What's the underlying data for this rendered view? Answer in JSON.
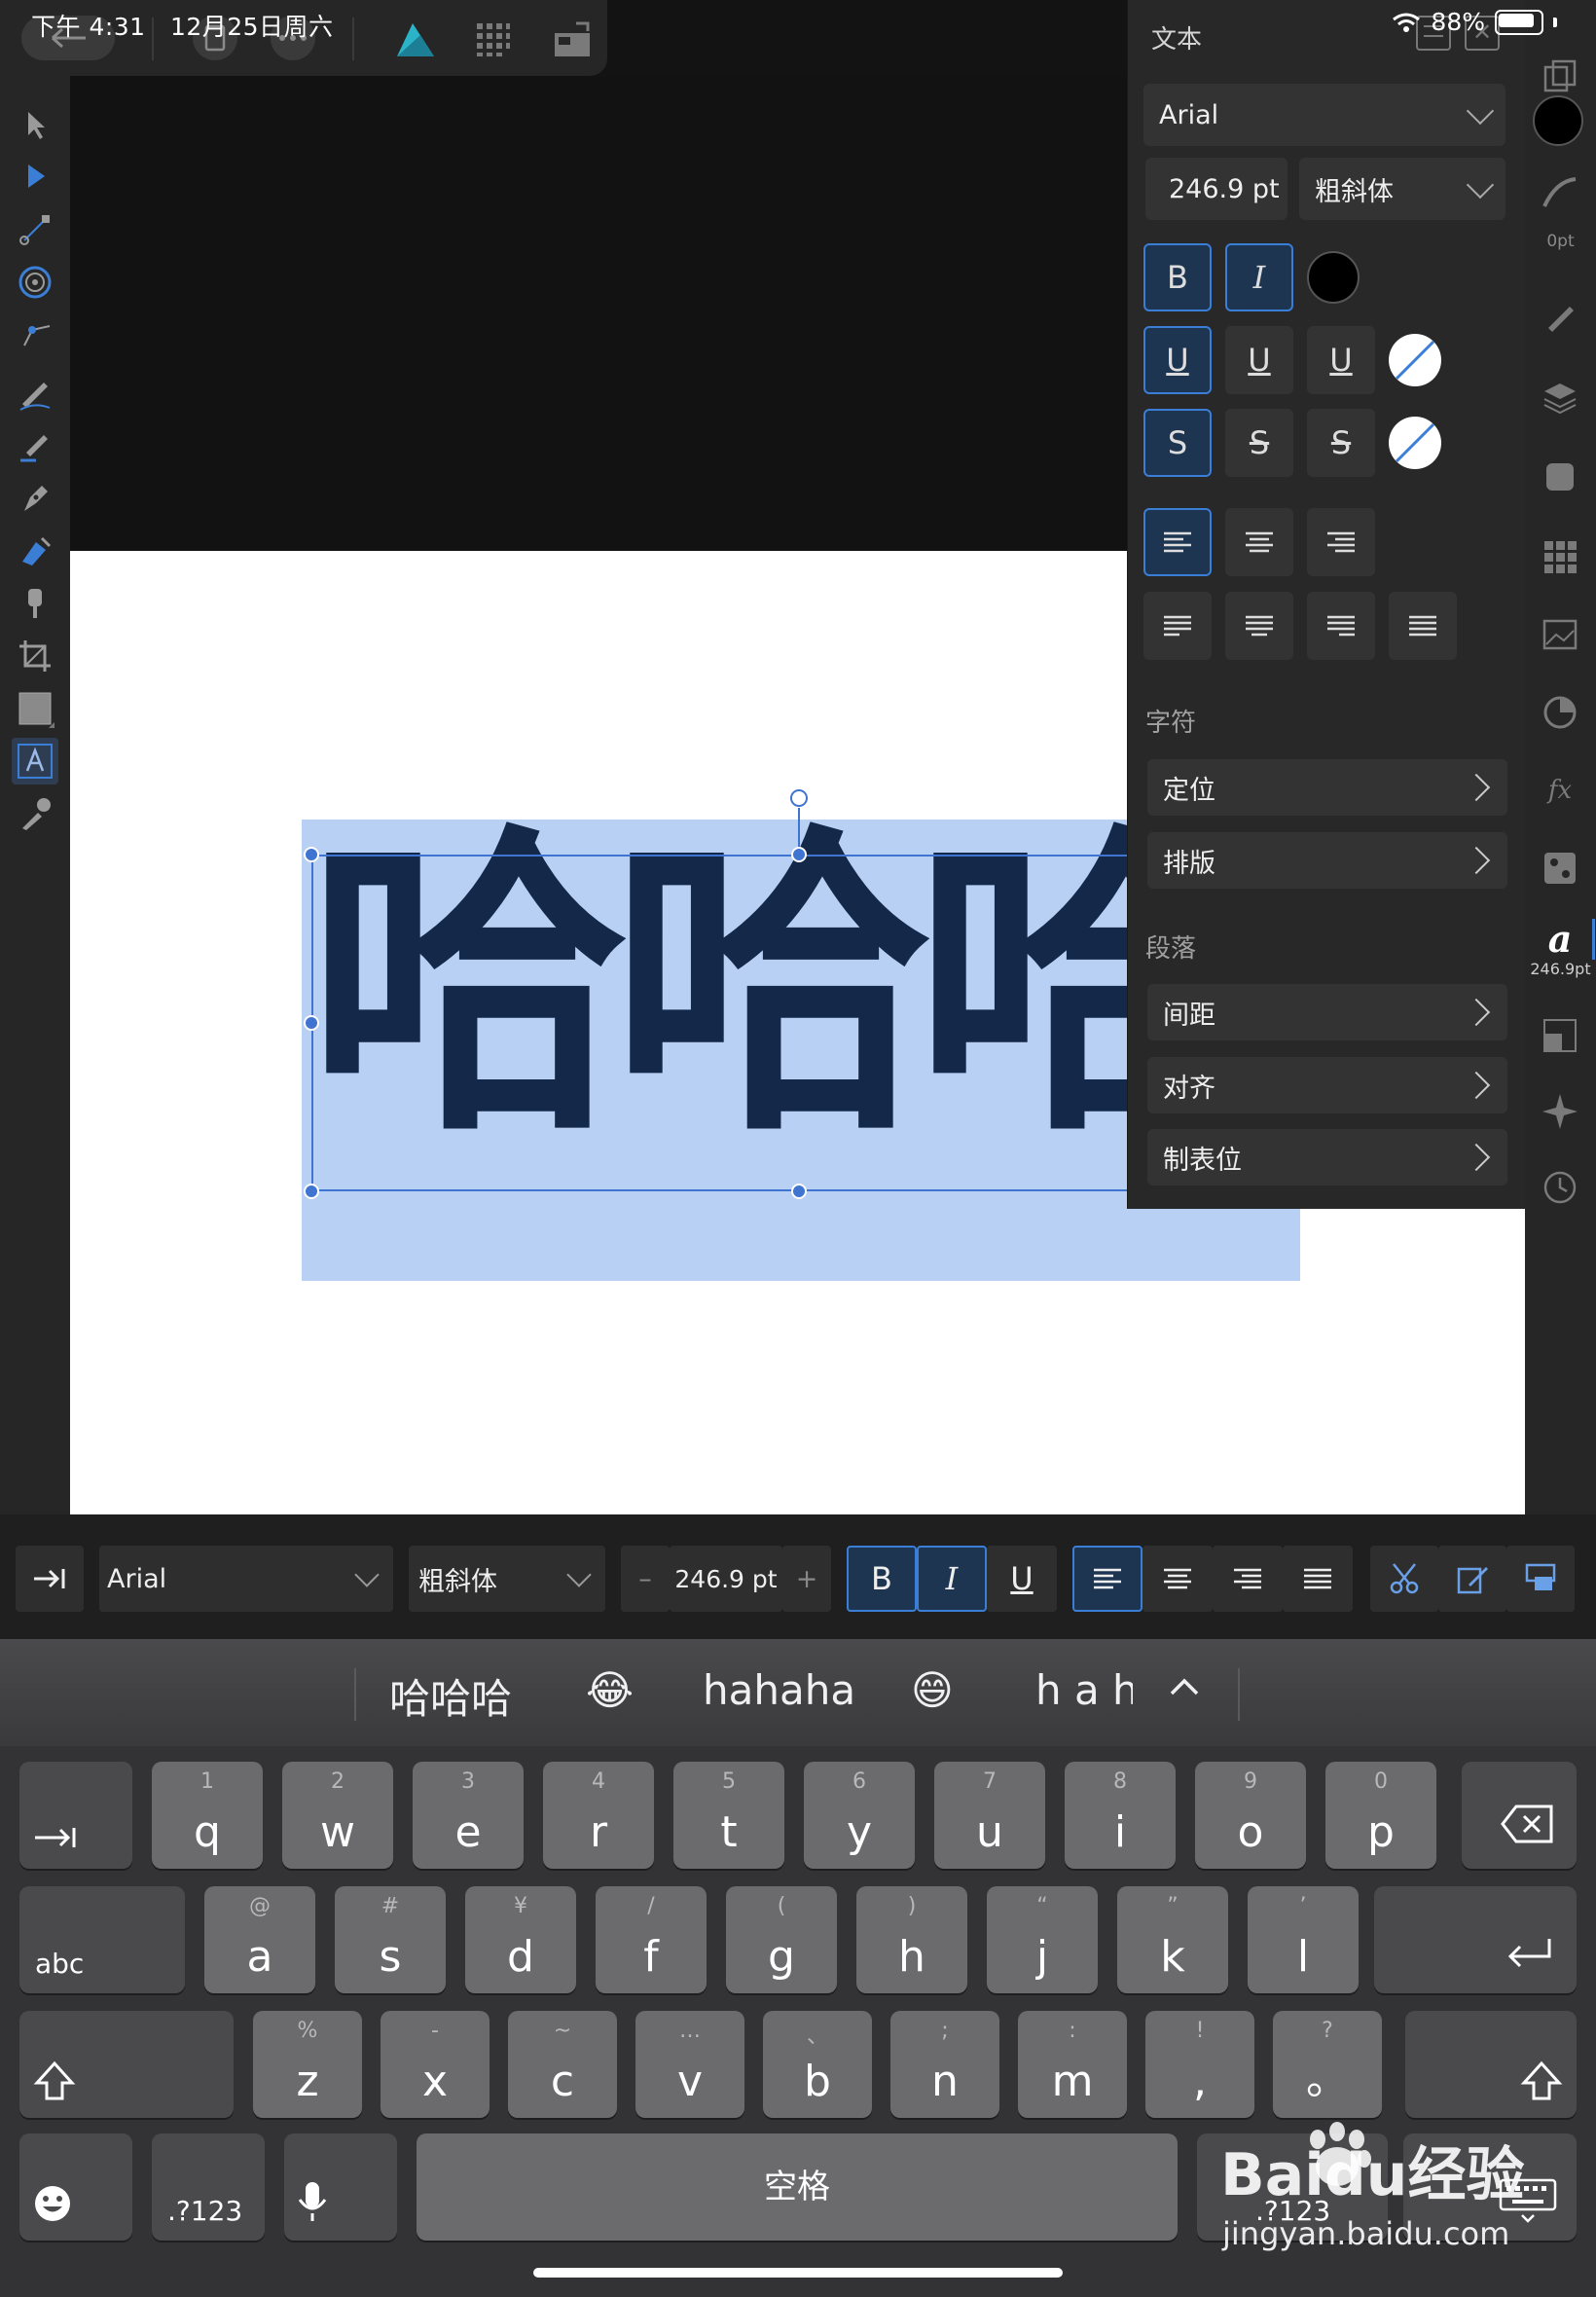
{
  "status_bar": {
    "time": "下午 4:31",
    "date": "12月25日周六",
    "battery": "88%"
  },
  "canvas": {
    "text": "哈哈哈"
  },
  "text_panel": {
    "title": "文本",
    "font": "Arial",
    "size": "246.9 pt",
    "style": "粗斜体",
    "bold_label": "B",
    "italic_label": "I",
    "underline_labels": [
      "U",
      "U",
      "U"
    ],
    "strike_labels": [
      "S",
      "S",
      "S"
    ],
    "character_section": "字符",
    "character_rows": [
      "定位",
      "排版"
    ],
    "paragraph_section": "段落",
    "paragraph_rows": [
      "间距",
      "对齐",
      "制表位"
    ]
  },
  "right_strip": {
    "stroke_width": "0pt",
    "text_size": "246.9pt",
    "text_glyph": "a"
  },
  "context_toolbar": {
    "font": "Arial",
    "style": "粗斜体",
    "size": "246.9 pt",
    "minus": "–",
    "plus": "+",
    "bold": "B",
    "italic": "I",
    "underline": "U"
  },
  "keyboard": {
    "suggestions": [
      "哈哈哈",
      "😂",
      "hahaha",
      "😄",
      "h a h"
    ],
    "row1": [
      {
        "hint": "1",
        "key": "q"
      },
      {
        "hint": "2",
        "key": "w"
      },
      {
        "hint": "3",
        "key": "e"
      },
      {
        "hint": "4",
        "key": "r"
      },
      {
        "hint": "5",
        "key": "t"
      },
      {
        "hint": "6",
        "key": "y"
      },
      {
        "hint": "7",
        "key": "u"
      },
      {
        "hint": "8",
        "key": "i"
      },
      {
        "hint": "9",
        "key": "o"
      },
      {
        "hint": "0",
        "key": "p"
      }
    ],
    "row2": [
      {
        "hint": "@",
        "key": "a"
      },
      {
        "hint": "#",
        "key": "s"
      },
      {
        "hint": "¥",
        "key": "d"
      },
      {
        "hint": "/",
        "key": "f"
      },
      {
        "hint": "(",
        "key": "g"
      },
      {
        "hint": ")",
        "key": "h"
      },
      {
        "hint": "“",
        "key": "j"
      },
      {
        "hint": "”",
        "key": "k"
      },
      {
        "hint": "’",
        "key": "l"
      }
    ],
    "row3": [
      {
        "hint": "%",
        "key": "z"
      },
      {
        "hint": "-",
        "key": "x"
      },
      {
        "hint": "~",
        "key": "c"
      },
      {
        "hint": "…",
        "key": "v"
      },
      {
        "hint": "、",
        "key": "b"
      },
      {
        "hint": ";",
        "key": "n"
      },
      {
        "hint": ":",
        "key": "m"
      },
      {
        "hint": "!",
        "key": ","
      },
      {
        "hint": "?",
        "key": "。"
      }
    ],
    "abc": "abc",
    "num": ".?123",
    "num2": ".?123",
    "space": "空格"
  },
  "watermark": {
    "brand": "Baidu经验",
    "url": "jingyan.baidu.com"
  },
  "colors": {
    "accent": "#3b7ed6",
    "text_fill": "#142849",
    "selection": "#b8d0f3"
  }
}
